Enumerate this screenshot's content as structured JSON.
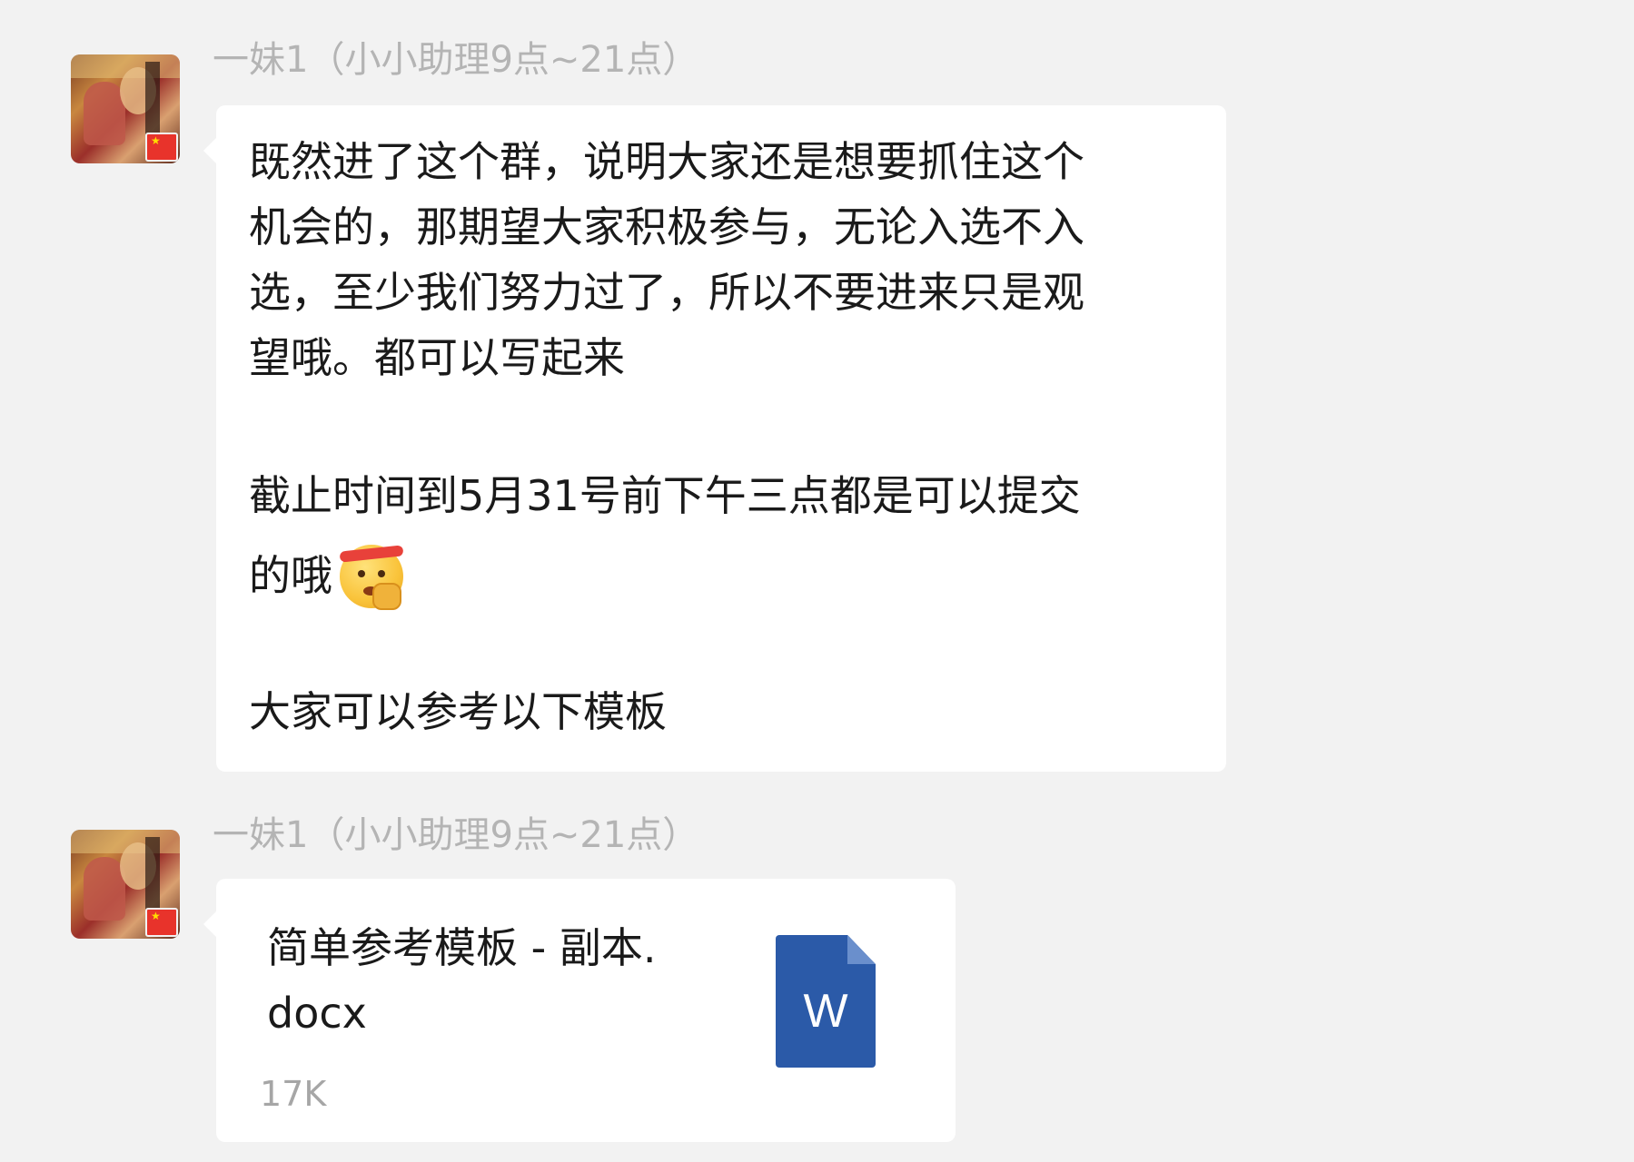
{
  "messages": [
    {
      "sender": "一妹1（小小助理9点~21点）",
      "lines": [
        "既然进了这个群，说明大家还是想要抓住这个",
        "机会的，那期望大家积极参与，无论入选不入",
        "选，至少我们努力过了，所以不要进来只是观",
        "望哦。都可以写起来",
        "截止时间到5月31号前下午三点都是可以提交",
        "的哦",
        "大家可以参考以下模板"
      ],
      "emoji": "fighting-emoji"
    },
    {
      "sender": "一妹1（小小助理9点~21点）",
      "file": {
        "name_line1": "简单参考模板 - 副本.",
        "name_line2": "docx",
        "size": "17K",
        "icon_letter": "W",
        "icon": "word-document-icon"
      }
    }
  ],
  "colors": {
    "background": "#f2f2f2",
    "bubble": "#ffffff",
    "sender": "#b4b4b4",
    "text": "#1a1a1a",
    "file_size": "#a6a6a6",
    "word_blue": "#2b5aa8",
    "flag_red": "#e8332b"
  }
}
